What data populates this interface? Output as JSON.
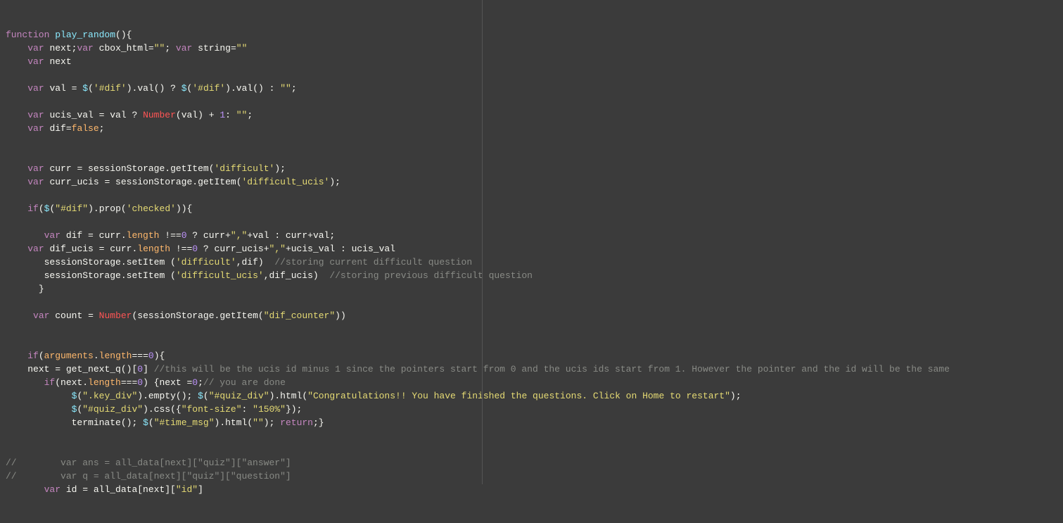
{
  "code": {
    "lines": [
      {
        "indent": 0,
        "segments": [
          [
            "k-purple",
            "function "
          ],
          [
            "cyan",
            "play_random"
          ],
          [
            "white",
            "(){"
          ]
        ]
      },
      {
        "indent": 1,
        "segments": [
          [
            "k-purple",
            "var "
          ],
          [
            "white",
            "next;"
          ],
          [
            "k-purple",
            "var "
          ],
          [
            "white",
            "cbox_html"
          ],
          [
            "white",
            "="
          ],
          [
            "string",
            "\"\""
          ],
          [
            "white",
            "; "
          ],
          [
            "k-purple",
            "var "
          ],
          [
            "white",
            "string"
          ],
          [
            "white",
            "="
          ],
          [
            "string",
            "\"\""
          ]
        ]
      },
      {
        "indent": 1,
        "segments": [
          [
            "k-purple",
            "var "
          ],
          [
            "white",
            "next"
          ]
        ]
      },
      {
        "indent": 0,
        "segments": []
      },
      {
        "indent": 1,
        "segments": [
          [
            "k-purple",
            "var "
          ],
          [
            "white",
            "val "
          ],
          [
            "white",
            "= "
          ],
          [
            "cyan",
            "$"
          ],
          [
            "white",
            "("
          ],
          [
            "string",
            "'#dif'"
          ],
          [
            "white",
            ")."
          ],
          [
            "white",
            "val"
          ],
          [
            "white",
            "() ? "
          ],
          [
            "cyan",
            "$"
          ],
          [
            "white",
            "("
          ],
          [
            "string",
            "'#dif'"
          ],
          [
            "white",
            ")."
          ],
          [
            "white",
            "val"
          ],
          [
            "white",
            "() : "
          ],
          [
            "string",
            "\"\""
          ],
          [
            "white",
            ";"
          ]
        ]
      },
      {
        "indent": 0,
        "segments": []
      },
      {
        "indent": 1,
        "segments": [
          [
            "k-purple",
            "var "
          ],
          [
            "white",
            "ucis_val "
          ],
          [
            "white",
            "= val ? "
          ],
          [
            "red",
            "Number"
          ],
          [
            "white",
            "(val) "
          ],
          [
            "white",
            "+ "
          ],
          [
            "number",
            "1"
          ],
          [
            "white",
            ": "
          ],
          [
            "string",
            "\"\""
          ],
          [
            "white",
            ";"
          ]
        ]
      },
      {
        "indent": 1,
        "segments": [
          [
            "k-purple",
            "var "
          ],
          [
            "white",
            "dif"
          ],
          [
            "white",
            "="
          ],
          [
            "orange",
            "false"
          ],
          [
            "white",
            ";"
          ]
        ]
      },
      {
        "indent": 0,
        "segments": []
      },
      {
        "indent": 0,
        "segments": []
      },
      {
        "indent": 1,
        "segments": [
          [
            "k-purple",
            "var "
          ],
          [
            "white",
            "curr "
          ],
          [
            "white",
            "= sessionStorage."
          ],
          [
            "white",
            "getItem"
          ],
          [
            "white",
            "("
          ],
          [
            "string",
            "'difficult'"
          ],
          [
            "white",
            ");"
          ]
        ]
      },
      {
        "indent": 1,
        "segments": [
          [
            "k-purple",
            "var "
          ],
          [
            "white",
            "curr_ucis "
          ],
          [
            "white",
            "= sessionStorage."
          ],
          [
            "white",
            "getItem"
          ],
          [
            "white",
            "("
          ],
          [
            "string",
            "'difficult_ucis'"
          ],
          [
            "white",
            ");"
          ]
        ]
      },
      {
        "indent": 0,
        "segments": []
      },
      {
        "indent": 1,
        "segments": [
          [
            "k-purple",
            "if"
          ],
          [
            "white",
            "("
          ],
          [
            "cyan",
            "$"
          ],
          [
            "white",
            "("
          ],
          [
            "string",
            "\"#dif\""
          ],
          [
            "white",
            ")."
          ],
          [
            "white",
            "prop"
          ],
          [
            "white",
            "("
          ],
          [
            "string",
            "'checked'"
          ],
          [
            "white",
            ")){"
          ]
        ]
      },
      {
        "indent": 0,
        "segments": []
      },
      {
        "indent": 2,
        "segments": [
          [
            "k-purple",
            "var "
          ],
          [
            "white",
            "dif "
          ],
          [
            "white",
            "= curr."
          ],
          [
            "orange",
            "length"
          ],
          [
            "white",
            " !=="
          ],
          [
            "number",
            "0"
          ],
          [
            "white",
            " ? curr"
          ],
          [
            "white",
            "+"
          ],
          [
            "string",
            "\",\""
          ],
          [
            "white",
            "+val : curr+val;"
          ]
        ]
      },
      {
        "indent": 1,
        "segments": [
          [
            "k-purple",
            "var "
          ],
          [
            "white",
            "dif_ucis "
          ],
          [
            "white",
            "= curr."
          ],
          [
            "orange",
            "length"
          ],
          [
            "white",
            " !=="
          ],
          [
            "number",
            "0"
          ],
          [
            "white",
            " ? curr_ucis"
          ],
          [
            "white",
            "+"
          ],
          [
            "string",
            "\",\""
          ],
          [
            "white",
            "+ucis_val : ucis_val"
          ]
        ]
      },
      {
        "indent": 2,
        "segments": [
          [
            "white",
            "sessionStorage."
          ],
          [
            "white",
            "setItem "
          ],
          [
            "white",
            "("
          ],
          [
            "string",
            "'difficult'"
          ],
          [
            "white",
            ",dif)  "
          ],
          [
            "comment",
            "//storing current difficult question"
          ]
        ]
      },
      {
        "indent": 2,
        "segments": [
          [
            "white",
            "sessionStorage."
          ],
          [
            "white",
            "setItem "
          ],
          [
            "white",
            "("
          ],
          [
            "string",
            "'difficult_ucis'"
          ],
          [
            "white",
            ",dif_ucis)  "
          ],
          [
            "comment",
            "//storing previous difficult question"
          ]
        ]
      },
      {
        "indent": 2,
        "lead": -1,
        "segments": [
          [
            "white",
            "}"
          ]
        ]
      },
      {
        "indent": 0,
        "segments": []
      },
      {
        "indent": 1,
        "segments": [
          [
            "white",
            " "
          ],
          [
            "k-purple",
            "var "
          ],
          [
            "white",
            "count "
          ],
          [
            "white",
            "= "
          ],
          [
            "red",
            "Number"
          ],
          [
            "white",
            "(sessionStorage."
          ],
          [
            "white",
            "getItem"
          ],
          [
            "white",
            "("
          ],
          [
            "string",
            "\"dif_counter\""
          ],
          [
            "white",
            "))"
          ]
        ]
      },
      {
        "indent": 0,
        "segments": []
      },
      {
        "indent": 0,
        "segments": []
      },
      {
        "indent": 1,
        "segments": [
          [
            "k-purple",
            "if"
          ],
          [
            "white",
            "("
          ],
          [
            "orange",
            "arguments"
          ],
          [
            "white",
            "."
          ],
          [
            "orange",
            "length"
          ],
          [
            "white",
            "==="
          ],
          [
            "number",
            "0"
          ],
          [
            "white",
            "){"
          ]
        ]
      },
      {
        "indent": 1,
        "segments": [
          [
            "white",
            "next "
          ],
          [
            "white",
            "= "
          ],
          [
            "white",
            "get_next_q"
          ],
          [
            "white",
            "()["
          ],
          [
            "number",
            "0"
          ],
          [
            "white",
            "] "
          ],
          [
            "comment",
            "//this will be the ucis id minus 1 since the pointers start from 0 and the ucis ids start from 1. However the pointer and the id will be the same"
          ]
        ]
      },
      {
        "indent": 2,
        "segments": [
          [
            "k-purple",
            "if"
          ],
          [
            "white",
            "(next."
          ],
          [
            "orange",
            "length"
          ],
          [
            "white",
            "==="
          ],
          [
            "number",
            "0"
          ],
          [
            "white",
            ") {next ="
          ],
          [
            "number",
            "0"
          ],
          [
            "white",
            ";"
          ],
          [
            "comment",
            "// you are done"
          ]
        ]
      },
      {
        "indent": 3,
        "segments": [
          [
            "cyan",
            "$"
          ],
          [
            "white",
            "("
          ],
          [
            "string",
            "\".key_div\""
          ],
          [
            "white",
            ")."
          ],
          [
            "white",
            "empty"
          ],
          [
            "white",
            "(); "
          ],
          [
            "cyan",
            "$"
          ],
          [
            "white",
            "("
          ],
          [
            "string",
            "\"#quiz_div\""
          ],
          [
            "white",
            ")."
          ],
          [
            "white",
            "html"
          ],
          [
            "white",
            "("
          ],
          [
            "string",
            "\"Congratulations!! You have finished the questions. Click on Home to restart\""
          ],
          [
            "white",
            ");"
          ]
        ]
      },
      {
        "indent": 3,
        "segments": [
          [
            "cyan",
            "$"
          ],
          [
            "white",
            "("
          ],
          [
            "string",
            "\"#quiz_div\""
          ],
          [
            "white",
            ")."
          ],
          [
            "white",
            "css"
          ],
          [
            "white",
            "({"
          ],
          [
            "string",
            "\"font-size\""
          ],
          [
            "white",
            ": "
          ],
          [
            "string",
            "\"150%\""
          ],
          [
            "white",
            "});"
          ]
        ]
      },
      {
        "indent": 3,
        "segments": [
          [
            "white",
            "terminate"
          ],
          [
            "white",
            "(); "
          ],
          [
            "cyan",
            "$"
          ],
          [
            "white",
            "("
          ],
          [
            "string",
            "\"#time_msg\""
          ],
          [
            "white",
            ")."
          ],
          [
            "white",
            "html"
          ],
          [
            "white",
            "("
          ],
          [
            "string",
            "\"\""
          ],
          [
            "white",
            "); "
          ],
          [
            "k-purple",
            "return"
          ],
          [
            "white",
            ";}"
          ]
        ]
      },
      {
        "indent": 0,
        "segments": []
      },
      {
        "indent": 0,
        "segments": []
      },
      {
        "indent": 0,
        "segments": [
          [
            "comment",
            "//        var ans = all_data[next][\"quiz\"][\"answer\"]"
          ]
        ]
      },
      {
        "indent": 0,
        "segments": [
          [
            "comment",
            "//        var q = all_data[next][\"quiz\"][\"question\"]"
          ]
        ]
      },
      {
        "indent": 2,
        "segments": [
          [
            "k-purple",
            "var "
          ],
          [
            "white",
            "id "
          ],
          [
            "white",
            "= all_data[next]["
          ],
          [
            "string",
            "\"id\""
          ],
          [
            "white",
            "]"
          ]
        ]
      }
    ]
  }
}
